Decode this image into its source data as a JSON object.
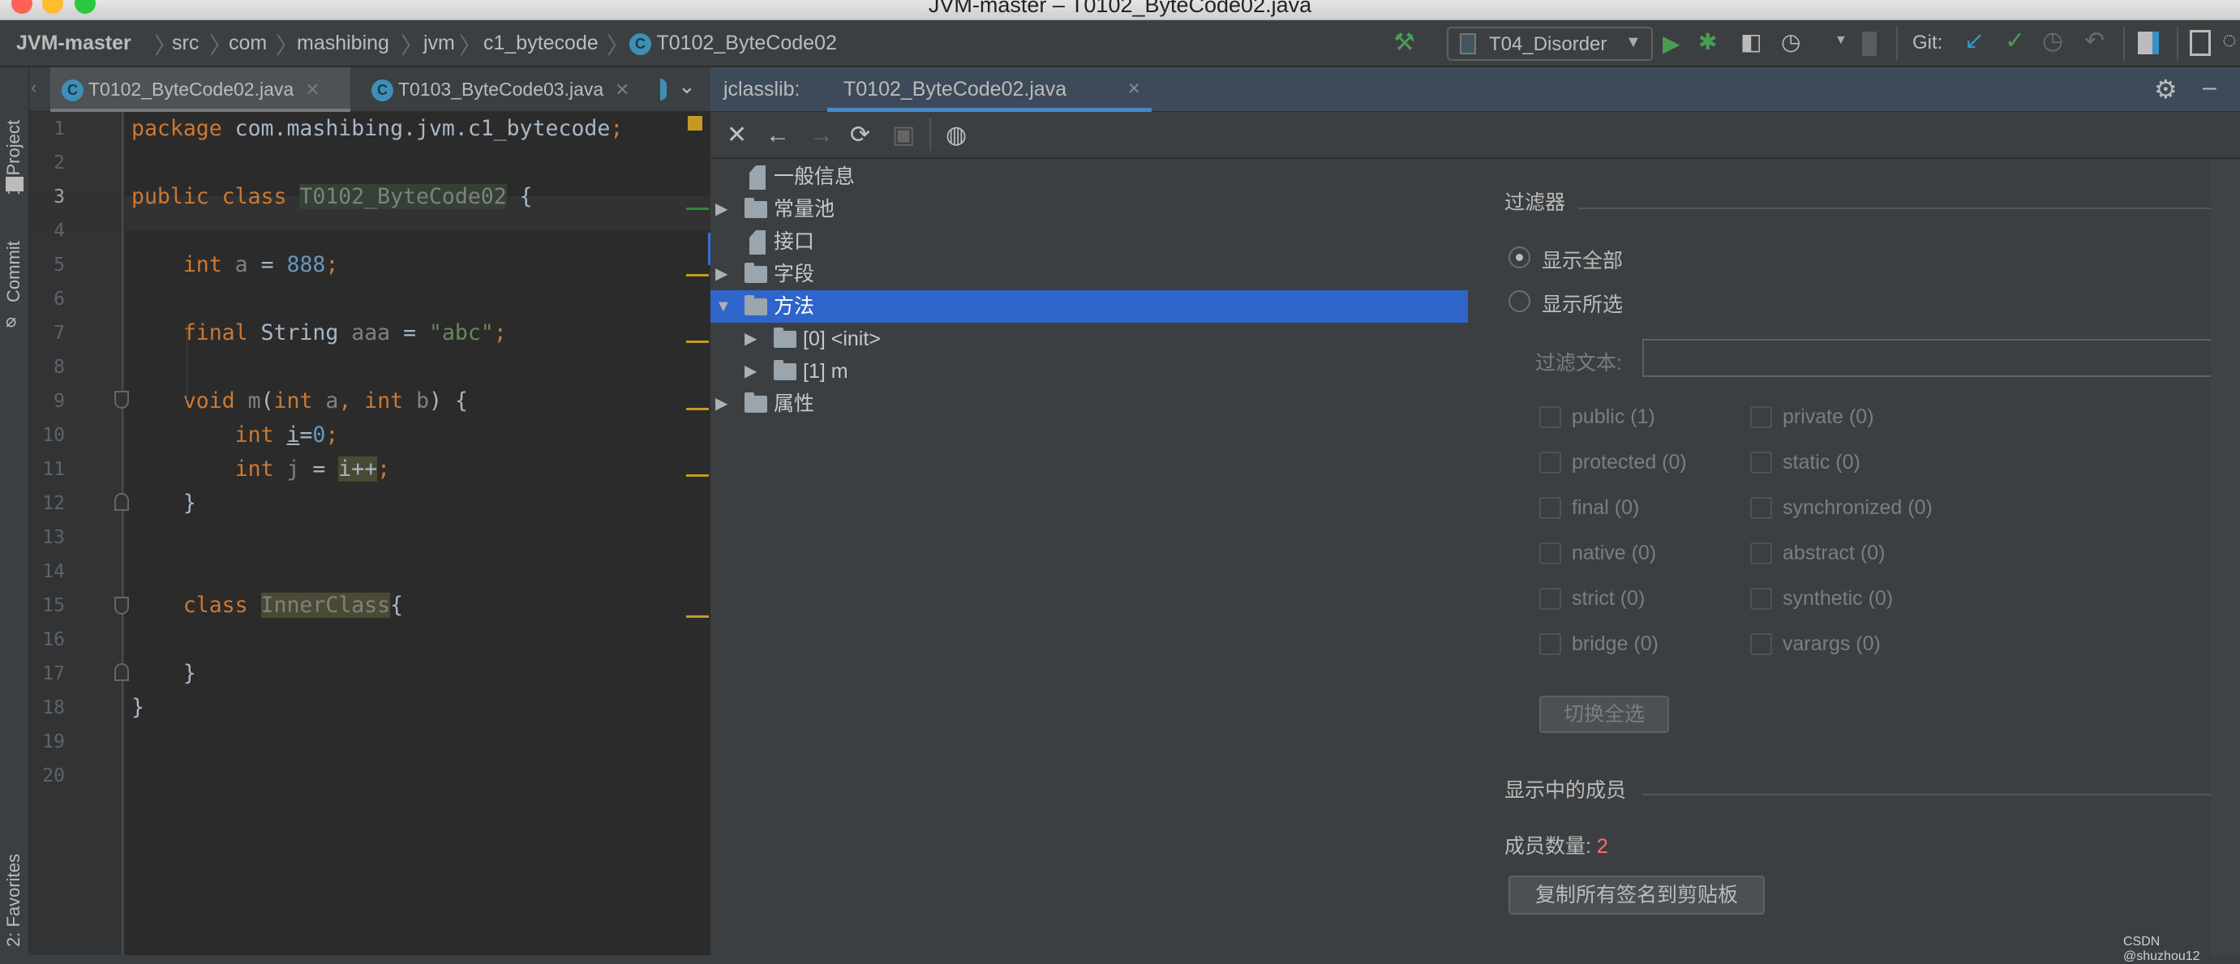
{
  "window": {
    "title": "JVM-master – T0102_ByteCode02.java"
  },
  "breadcrumb": [
    "JVM-master",
    "src",
    "com",
    "mashibing",
    "jvm",
    "c1_bytecode",
    "T0102_ByteCode02"
  ],
  "toolbar": {
    "run_config": "T04_Disorder",
    "git_label": "Git:"
  },
  "left_strip": {
    "project": "1: Project",
    "commit": "Commit",
    "favorites": "2: Favorites"
  },
  "editor_tabs": [
    {
      "label": "T0102_ByteCode02.java",
      "active": true
    },
    {
      "label": "T0103_ByteCode03.java",
      "active": false
    }
  ],
  "editor": {
    "current_line": 3,
    "line_numbers": [
      "1",
      "2",
      "3",
      "4",
      "5",
      "6",
      "7",
      "8",
      "9",
      "10",
      "11",
      "12",
      "13",
      "14",
      "15",
      "16",
      "17",
      "18",
      "19",
      "20"
    ],
    "lines": [
      [
        {
          "t": "package",
          "k": "keyword"
        },
        {
          "t": " com.mashibing.jvm.c1_bytecode",
          "k": "plain"
        },
        {
          "t": ";",
          "k": "keyword"
        }
      ],
      [],
      [
        {
          "t": "public class ",
          "k": "keyword"
        },
        {
          "t": "T0102_ByteCode02",
          "k": "classname"
        },
        {
          "t": " {",
          "k": "plain"
        }
      ],
      [],
      [
        {
          "t": "    int ",
          "k": "keyword"
        },
        {
          "t": "a",
          "k": "unused"
        },
        {
          "t": " = ",
          "k": "plain"
        },
        {
          "t": "888",
          "k": "number"
        },
        {
          "t": ";",
          "k": "keyword"
        }
      ],
      [],
      [
        {
          "t": "    final ",
          "k": "keyword"
        },
        {
          "t": "String ",
          "k": "plain"
        },
        {
          "t": "aaa",
          "k": "unused"
        },
        {
          "t": " = ",
          "k": "plain"
        },
        {
          "t": "\"abc\"",
          "k": "string"
        },
        {
          "t": ";",
          "k": "keyword"
        }
      ],
      [],
      [
        {
          "t": "    void ",
          "k": "keyword"
        },
        {
          "t": "m",
          "k": "unused"
        },
        {
          "t": "(",
          "k": "plain"
        },
        {
          "t": "int ",
          "k": "keyword"
        },
        {
          "t": "a",
          "k": "unused"
        },
        {
          "t": ", ",
          "k": "keyword"
        },
        {
          "t": "int ",
          "k": "keyword"
        },
        {
          "t": "b",
          "k": "unused"
        },
        {
          "t": ") {",
          "k": "plain"
        }
      ],
      [
        {
          "t": "        int ",
          "k": "keyword"
        },
        {
          "t": "i",
          "k": "ul"
        },
        {
          "t": "=",
          "k": "plain"
        },
        {
          "t": "0",
          "k": "number"
        },
        {
          "t": ";",
          "k": "keyword"
        }
      ],
      [
        {
          "t": "        int ",
          "k": "keyword"
        },
        {
          "t": "j",
          "k": "unused"
        },
        {
          "t": " = ",
          "k": "plain"
        },
        {
          "t": "i++",
          "k": "hl"
        },
        {
          "t": ";",
          "k": "keyword"
        }
      ],
      [
        {
          "t": "    }",
          "k": "plain"
        }
      ],
      [],
      [],
      [
        {
          "t": "    class ",
          "k": "keyword"
        },
        {
          "t": "InnerClass",
          "k": "innerclass"
        },
        {
          "t": "{",
          "k": "plain"
        }
      ],
      [],
      [
        {
          "t": "    }",
          "k": "plain"
        }
      ],
      [
        {
          "t": "}",
          "k": "plain"
        }
      ],
      [],
      []
    ]
  },
  "jclasslib": {
    "prefix": "jclasslib:",
    "tab": "T0102_ByteCode02.java",
    "tree": [
      {
        "label": "一般信息",
        "icon": "file",
        "level": 0,
        "expander": "none"
      },
      {
        "label": "常量池",
        "icon": "folder",
        "level": 0,
        "expander": "collapsed"
      },
      {
        "label": "接口",
        "icon": "file",
        "level": 0,
        "expander": "none"
      },
      {
        "label": "字段",
        "icon": "folder",
        "level": 0,
        "expander": "collapsed"
      },
      {
        "label": "方法",
        "icon": "folder",
        "level": 0,
        "expander": "expanded",
        "selected": true
      },
      {
        "label": "[0] <init>",
        "icon": "folder",
        "level": 1,
        "expander": "collapsed"
      },
      {
        "label": "[1] m",
        "icon": "folder",
        "level": 1,
        "expander": "collapsed"
      },
      {
        "label": "属性",
        "icon": "folder",
        "level": 0,
        "expander": "collapsed"
      }
    ],
    "filter": {
      "title": "过滤器",
      "show_all": "显示全部",
      "show_selected": "显示所选",
      "selected_mode": "show_all",
      "filter_text_label": "过滤文本:",
      "filter_text_value": "",
      "checkboxes": [
        [
          "public (1)",
          "private (0)"
        ],
        [
          "protected (0)",
          "static (0)"
        ],
        [
          "final (0)",
          "synchronized (0)"
        ],
        [
          "native (0)",
          "abstract (0)"
        ],
        [
          "strict (0)",
          "synthetic (0)"
        ],
        [
          "bridge (0)",
          "varargs (0)"
        ]
      ],
      "toggle_all": "切换全选"
    },
    "members": {
      "title": "显示中的成员",
      "count_label": "成员数量:",
      "count": "2",
      "count_color": "#ff6b68",
      "copy_button": "复制所有签名到剪贴板"
    }
  },
  "watermark": "CSDN @shuzhou12"
}
